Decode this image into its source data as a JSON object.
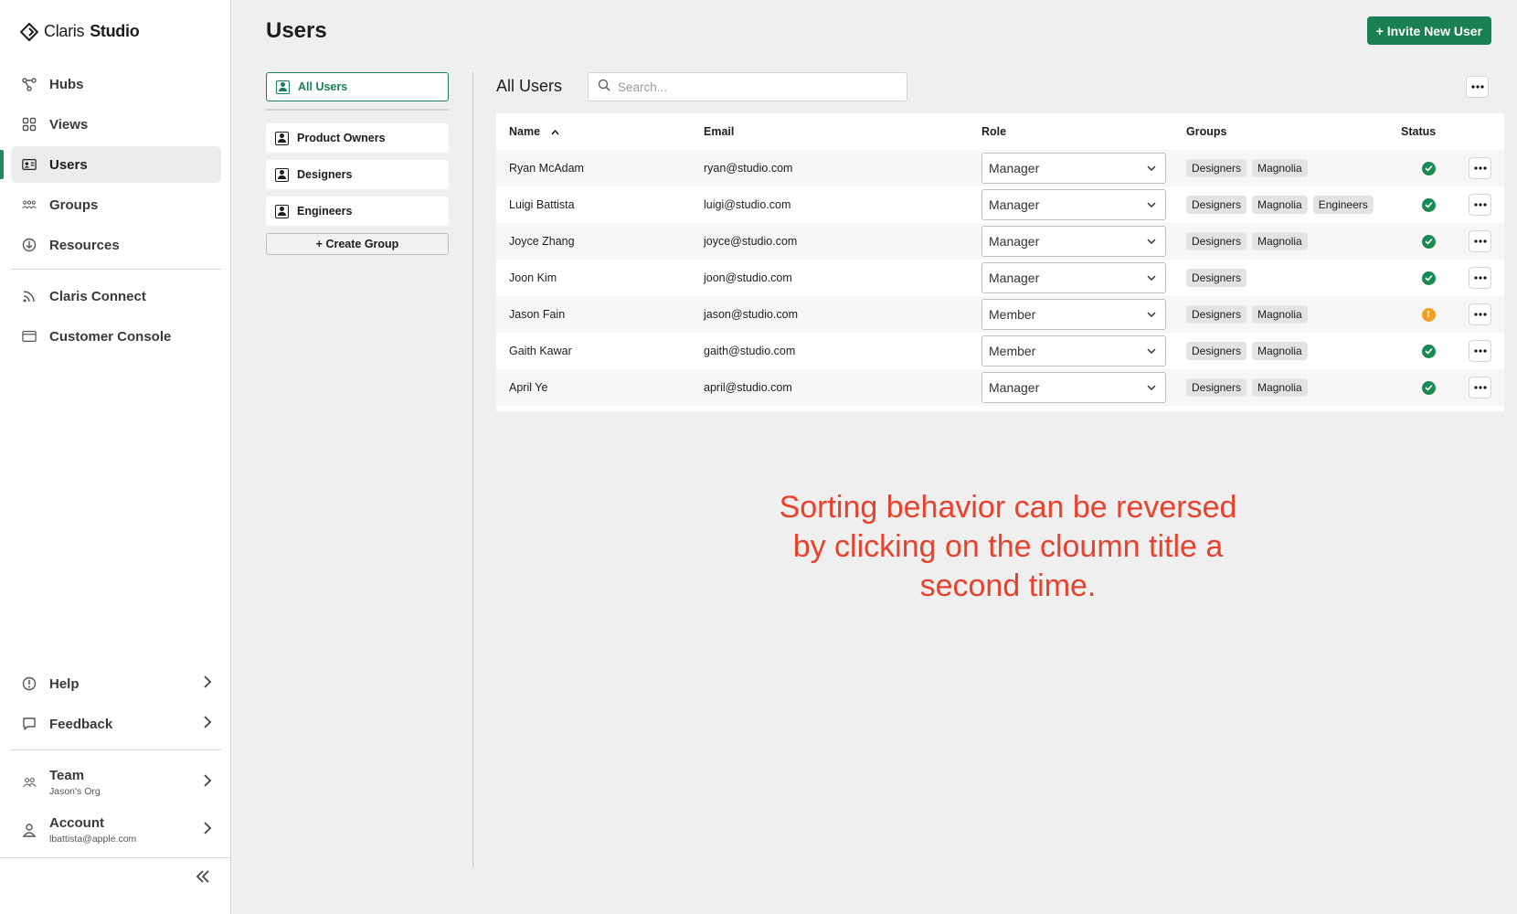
{
  "app": {
    "brand_a": "Claris",
    "brand_b": "Studio"
  },
  "sidebar": {
    "nav": [
      {
        "label": "Hubs",
        "icon": "hubs-icon"
      },
      {
        "label": "Views",
        "icon": "views-icon"
      },
      {
        "label": "Users",
        "icon": "users-icon",
        "active": true
      },
      {
        "label": "Groups",
        "icon": "groups-icon"
      },
      {
        "label": "Resources",
        "icon": "resources-icon"
      }
    ],
    "secondary": [
      {
        "label": "Claris Connect",
        "icon": "connect-icon"
      },
      {
        "label": "Customer Console",
        "icon": "console-icon"
      }
    ],
    "help": {
      "label": "Help"
    },
    "feedback": {
      "label": "Feedback"
    },
    "team": {
      "label": "Team",
      "sub": "Jason's Org"
    },
    "account": {
      "label": "Account",
      "sub": "lbattista@apple.com"
    }
  },
  "header": {
    "title": "Users",
    "invite_label": "+ Invite New User"
  },
  "groups_panel": {
    "selected": "All Users",
    "groups": [
      "Product Owners",
      "Designers",
      "Engineers"
    ],
    "create_label": "+ Create Group"
  },
  "main": {
    "title": "All Users",
    "search_placeholder": "Search...",
    "columns": {
      "name": "Name",
      "email": "Email",
      "role": "Role",
      "groups": "Groups",
      "status": "Status"
    },
    "sort": {
      "column": "name",
      "direction": "ascending"
    },
    "rows": [
      {
        "name": "Ryan McAdam",
        "email": "ryan@studio.com",
        "role": "Manager",
        "groups": [
          "Designers",
          "Magnolia"
        ],
        "status": "active"
      },
      {
        "name": "Luigi Battista",
        "email": "luigi@studio.com",
        "role": "Manager",
        "groups": [
          "Designers",
          "Magnolia",
          "Engineers"
        ],
        "status": "active"
      },
      {
        "name": "Joyce Zhang",
        "email": "joyce@studio.com",
        "role": "Manager",
        "groups": [
          "Designers",
          "Magnolia"
        ],
        "status": "active"
      },
      {
        "name": "Joon Kim",
        "email": "joon@studio.com",
        "role": "Manager",
        "groups": [
          "Designers"
        ],
        "status": "active"
      },
      {
        "name": "Jason Fain",
        "email": "jason@studio.com",
        "role": "Member",
        "groups": [
          "Designers",
          "Magnolia"
        ],
        "status": "warning"
      },
      {
        "name": "Gaith Kawar",
        "email": "gaith@studio.com",
        "role": "Member",
        "groups": [
          "Designers",
          "Magnolia"
        ],
        "status": "active"
      },
      {
        "name": "April Ye",
        "email": "april@studio.com",
        "role": "Manager",
        "groups": [
          "Designers",
          "Magnolia"
        ],
        "status": "active"
      }
    ]
  },
  "annotation": "Sorting behavior can be reversed by clicking on the cloumn title a second time.",
  "colors": {
    "accent": "#1a7f52",
    "status_active": "#1a8a55",
    "status_warning": "#f0a020",
    "annotation": "#e8412c"
  }
}
